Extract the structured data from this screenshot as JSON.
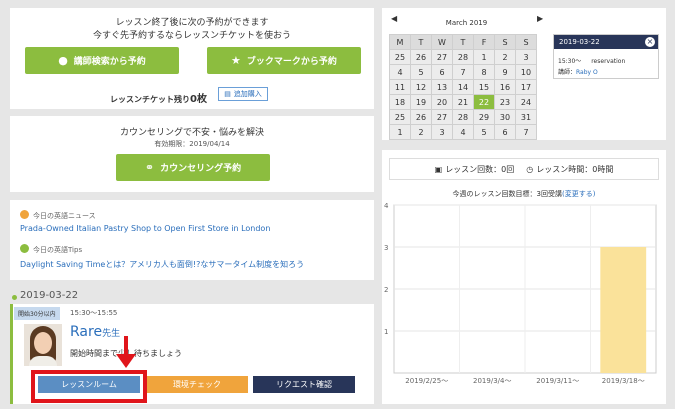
{
  "top_panel": {
    "line1": "レッスン終了後に次の予約ができます",
    "line2": "今すぐ先予約するならレッスンチケットを使おう",
    "teacher_search_btn": "講師検索から予約",
    "bookmark_btn": "ブックマークから予約",
    "ticket_remaining_label": "レッスンチケット残り",
    "ticket_remaining_value": "0枚",
    "add_purchase_btn": "追加購入"
  },
  "counseling": {
    "line1": "カウンセリングで不安・悩みを解決",
    "expiry": "有効期限：2019/04/14",
    "btn": "カウンセリング予約"
  },
  "news": {
    "label1": "今日の英語ニュース",
    "link1": "Prada-Owned Italian Pastry Shop to Open First Store in London",
    "label2": "今日の英語Tips",
    "link2": "Daylight Saving Timeとは？アメリカ人も面倒!?なサマータイム制度を知ろう"
  },
  "lesson": {
    "date": "2019-03-22",
    "badge": "開始30分以内",
    "time": "15:30～15:55",
    "teacher_name": "Rare",
    "teacher_suffix": "先生",
    "message": "開始時間まで少し待ちましょう",
    "btn_room": "レッスンルーム",
    "btn_check": "環境チェック",
    "btn_request": "リクエスト確認",
    "colors": {
      "room": "#5b8ec3",
      "check": "#f0a43c",
      "request": "#283559",
      "annotation": "#e0151b"
    }
  },
  "calendar": {
    "month": "March 2019",
    "headers": [
      "M",
      "T",
      "W",
      "T",
      "F",
      "S",
      "S"
    ],
    "rows": [
      [
        "25",
        "26",
        "27",
        "28",
        "1",
        "2",
        "3"
      ],
      [
        "4",
        "5",
        "6",
        "7",
        "8",
        "9",
        "10"
      ],
      [
        "11",
        "12",
        "13",
        "14",
        "15",
        "16",
        "17"
      ],
      [
        "18",
        "19",
        "20",
        "21",
        "22",
        "23",
        "24"
      ],
      [
        "25",
        "26",
        "27",
        "28",
        "29",
        "30",
        "31"
      ],
      [
        "1",
        "2",
        "3",
        "4",
        "5",
        "6",
        "7"
      ]
    ],
    "selected": "22"
  },
  "reservation": {
    "date": "2019-03-22",
    "time": "15:30～",
    "label": "reservation",
    "teacher_label": "講師：",
    "teacher": "Raby O"
  },
  "stats": {
    "lesson_count": "レッスン回数：0回",
    "lesson_time": "レッスン時間：0時間",
    "goal_text": "今週のレッスン回数目標：",
    "goal_value": "3回受講",
    "goal_change": "(変更する)"
  },
  "chart_data": {
    "type": "bar",
    "categories": [
      "2019/2/25～",
      "2019/3/4～",
      "2019/3/11～",
      "2019/3/18～"
    ],
    "values": [
      0,
      0,
      0,
      3
    ],
    "ylim": [
      0,
      4
    ],
    "yticks": [
      "4",
      "3",
      "2",
      "1"
    ],
    "goal_line": 3,
    "bar_color": "#fae29a"
  }
}
